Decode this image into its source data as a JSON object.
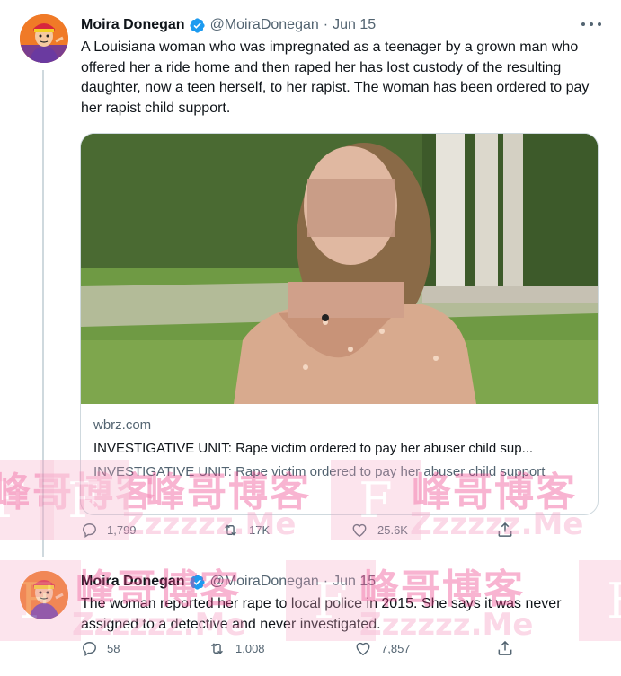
{
  "tweets": [
    {
      "author": {
        "display_name": "Moira Donegan",
        "handle": "@MoiraDonegan",
        "verified": true,
        "avatar_icon": "cartoon-avatar-icon"
      },
      "separator": "·",
      "date": "Jun 15",
      "text": "A Louisiana woman who was impregnated as a teenager by a grown man who offered her a ride home and then raped her has lost custody of the resulting daughter, now a teen herself, to her rapist. The woman has been ordered to pay her rapist child support.",
      "card": {
        "domain": "wbrz.com",
        "title": "INVESTIGATIVE UNIT: Rape victim ordered to pay her abuser child sup...",
        "description": "INVESTIGATIVE UNIT: Rape victim ordered to pay her abuser child support"
      },
      "actions": {
        "replies": "1,799",
        "retweets": "17K",
        "likes": "25.6K"
      }
    },
    {
      "author": {
        "display_name": "Moira Donegan",
        "handle": "@MoiraDonegan",
        "verified": true,
        "avatar_icon": "cartoon-avatar-icon"
      },
      "separator": "·",
      "date": "Jun 15",
      "text": "The woman reported her rape to local police in 2015. She says it was never assigned to a detective and never investigated.",
      "actions": {
        "replies": "58",
        "retweets": "1,008",
        "likes": "7,857"
      }
    }
  ],
  "watermark": {
    "letter": "F",
    "chinese": "峰哥博客",
    "english": "Zzzzzz.Me"
  },
  "colors": {
    "verified": "#1d9bf0",
    "secondary_text": "#536471",
    "border": "#cfd9de",
    "watermark_pink": "#ec3d86"
  }
}
